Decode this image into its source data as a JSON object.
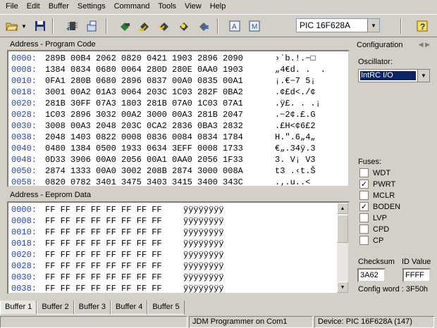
{
  "menu": [
    "File",
    "Edit",
    "Buffer",
    "Settings",
    "Command",
    "Tools",
    "View",
    "Help"
  ],
  "toolbar": {
    "buttons": [
      "open-icon",
      "save-icon",
      "read-device-icon",
      "write-device-icon",
      "erase-icon",
      "verify-icon",
      "program-icon",
      "blank-check-icon",
      "run-icon",
      "device-a-icon",
      "device-b-icon",
      "help-icon"
    ],
    "device": "PIC 16F628A"
  },
  "program": {
    "title": "Address - Program Code",
    "rows": [
      {
        "addr": "0000:",
        "bytes": "289B 00B4 2062 0820 0421 1903 2896 2090",
        "ascii": "›´b.!.−□"
      },
      {
        "addr": "0008:",
        "bytes": "1384 0834 0680 0064 280D 280E 0AA0 1903",
        "ascii": "„4€d. .  ."
      },
      {
        "addr": "0010:",
        "bytes": "0FA1 280B 0680 2896 0837 00A0 0835 00A1",
        "ascii": "¡.€−7 5¡"
      },
      {
        "addr": "0018:",
        "bytes": "3001 00A2 01A3 0064 203C 1C03 282F 0BA2",
        "ascii": ".¢£d<./¢"
      },
      {
        "addr": "0020:",
        "bytes": "281B 30FF 07A3 1803 281B 07A0 1C03 07A1",
        "ascii": ".ÿ£. . .¡"
      },
      {
        "addr": "0028:",
        "bytes": "1C03 2896 3032 00A2 3000 00A3 281B 2047",
        "ascii": ".−2¢.£.G"
      },
      {
        "addr": "0030:",
        "bytes": "3008 00A3 2048 203C 0CA2 2836 0BA3 2832",
        "ascii": ".£H<¢6£2"
      },
      {
        "addr": "0038:",
        "bytes": "2048 1403 0822 0008 0836 0084 0834 1784",
        "ascii": "H.\".6„4„"
      },
      {
        "addr": "0040:",
        "bytes": "0480 1384 0500 1933 0634 3EFF 0008 1733",
        "ascii": "€„.34ÿ.3"
      },
      {
        "addr": "0048:",
        "bytes": "0D33 3906 00A0 2056 00A1 0AA0 2056 1F33",
        "ascii": "3. V¡ V3"
      },
      {
        "addr": "0050:",
        "bytes": "2874 1333 00A0 3002 208B 2874 3000 008A",
        "ascii": "t3 .‹t.Š"
      },
      {
        "addr": "0058:",
        "bytes": "0820 0782 3401 3475 3403 3415 3400 343C",
        "ascii": ".‚.u..<"
      }
    ]
  },
  "eeprom": {
    "title": "Address - Eeprom Data",
    "rows": [
      {
        "addr": "0000:",
        "bytes": "FF FF FF FF FF FF FF FF",
        "ascii": "ÿÿÿÿÿÿÿÿ"
      },
      {
        "addr": "0008:",
        "bytes": "FF FF FF FF FF FF FF FF",
        "ascii": "ÿÿÿÿÿÿÿÿ"
      },
      {
        "addr": "0010:",
        "bytes": "FF FF FF FF FF FF FF FF",
        "ascii": "ÿÿÿÿÿÿÿÿ"
      },
      {
        "addr": "0018:",
        "bytes": "FF FF FF FF FF FF FF FF",
        "ascii": "ÿÿÿÿÿÿÿÿ"
      },
      {
        "addr": "0020:",
        "bytes": "FF FF FF FF FF FF FF FF",
        "ascii": "ÿÿÿÿÿÿÿÿ"
      },
      {
        "addr": "0028:",
        "bytes": "FF FF FF FF FF FF FF FF",
        "ascii": "ÿÿÿÿÿÿÿÿ"
      },
      {
        "addr": "0030:",
        "bytes": "FF FF FF FF FF FF FF FF",
        "ascii": "ÿÿÿÿÿÿÿÿ"
      },
      {
        "addr": "0038:",
        "bytes": "FF FF FF FF FF FF FF FF",
        "ascii": "ÿÿÿÿÿÿÿÿ"
      }
    ]
  },
  "config": {
    "title": "Configuration",
    "oscillator_label": "Oscillator:",
    "oscillator": "IntRC I/O",
    "fuses_label": "Fuses:",
    "fuses": [
      {
        "name": "WDT",
        "checked": false
      },
      {
        "name": "PWRT",
        "checked": true
      },
      {
        "name": "MCLR",
        "checked": false
      },
      {
        "name": "BODEN",
        "checked": true
      },
      {
        "name": "LVP",
        "checked": false
      },
      {
        "name": "CPD",
        "checked": false
      },
      {
        "name": "CP",
        "checked": false
      }
    ],
    "checksum_label": "Checksum",
    "checksum": "3A62",
    "id_label": "ID Value",
    "id_value": "FFFF",
    "config_word": "Config word : 3F50h"
  },
  "tabs": [
    "Buffer 1",
    "Buffer 2",
    "Buffer 3",
    "Buffer 4",
    "Buffer 5"
  ],
  "status": {
    "programmer": "JDM Programmer on Com1",
    "device": "Device: PIC 16F628A  (147)"
  },
  "colors": {
    "address": "#1f3fbf",
    "selection": "#0a246a"
  }
}
